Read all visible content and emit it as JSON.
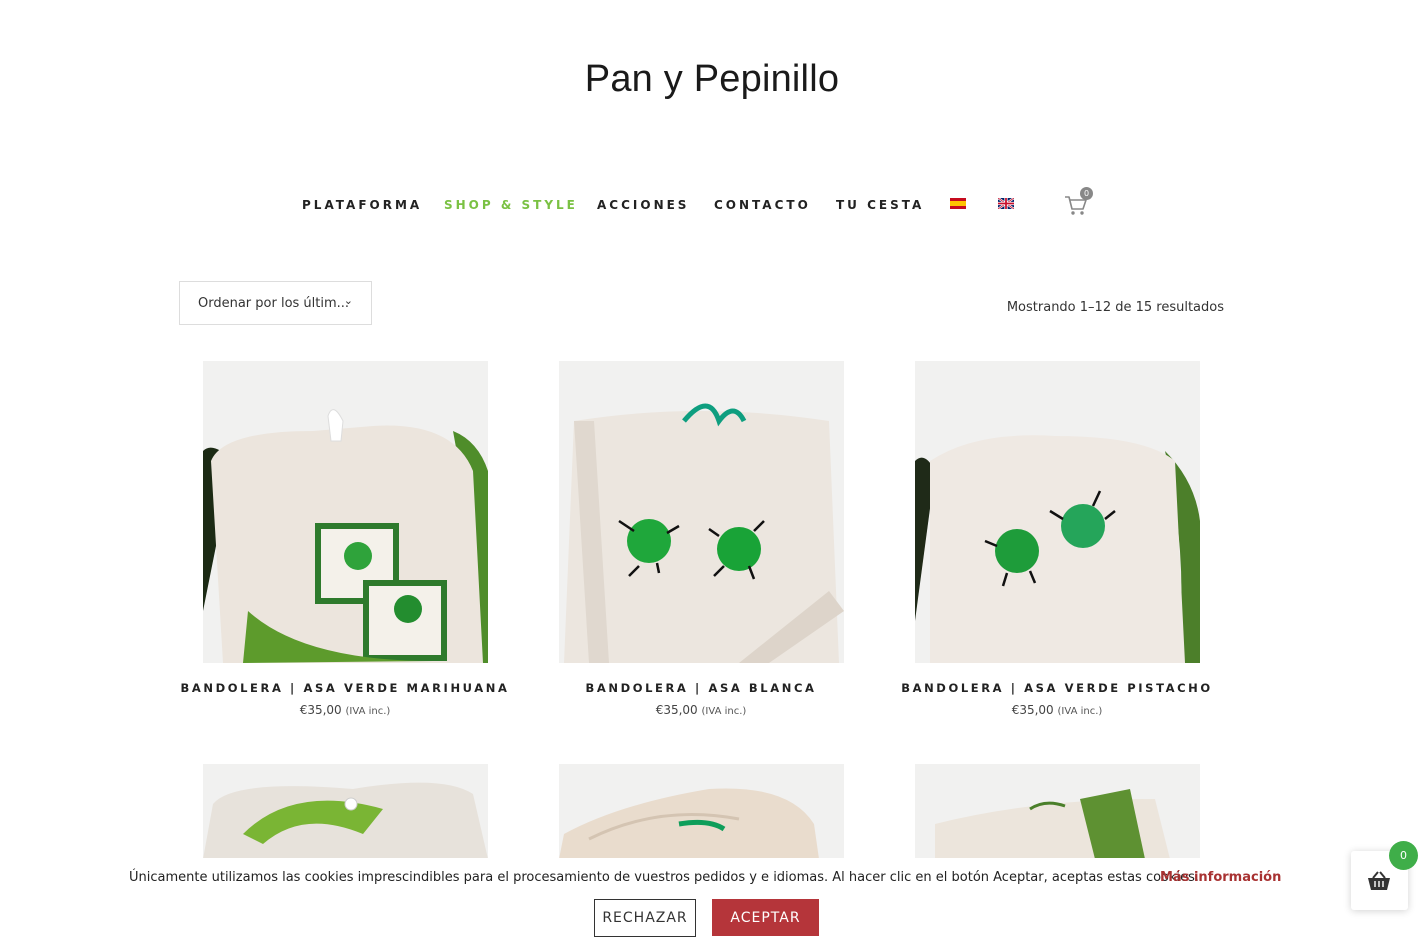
{
  "site": {
    "logo": "Pan y Pepinillo"
  },
  "nav": {
    "items": [
      {
        "label": "PLATAFORMA"
      },
      {
        "label": "SHOP & STYLE"
      },
      {
        "label": "ACCIONES"
      },
      {
        "label": "CONTACTO"
      },
      {
        "label": "TU CESTA"
      }
    ],
    "active_color": "#7ac143",
    "languages": [
      "es-flag-icon",
      "uk-flag-icon"
    ],
    "cart_count": "0"
  },
  "toolbar": {
    "sort_label": "Ordenar por los últim...",
    "result_count": "Mostrando 1–12 de 15 resultados"
  },
  "products": [
    {
      "title": "BANDOLERA | ASA VERDE MARIHUANA",
      "price": "€35,00",
      "tax": "(IVA inc.)"
    },
    {
      "title": "BANDOLERA | ASA BLANCA",
      "price": "€35,00",
      "tax": "(IVA inc.)"
    },
    {
      "title": "BANDOLERA | ASA VERDE PISTACHO",
      "price": "€35,00",
      "tax": "(IVA inc.)"
    }
  ],
  "cookie": {
    "text": "Únicamente utilizamos las cookies imprescindibles para el procesamiento de vuestros pedidos y e idiomas. Al hacer clic en el botón Aceptar, aceptas estas cookies.",
    "link": "Más información",
    "reject": "RECHAZAR",
    "accept": "ACEPTAR",
    "accept_color": "#b5353a"
  },
  "floating_cart": {
    "count": "0",
    "badge_color": "#3fae49"
  }
}
